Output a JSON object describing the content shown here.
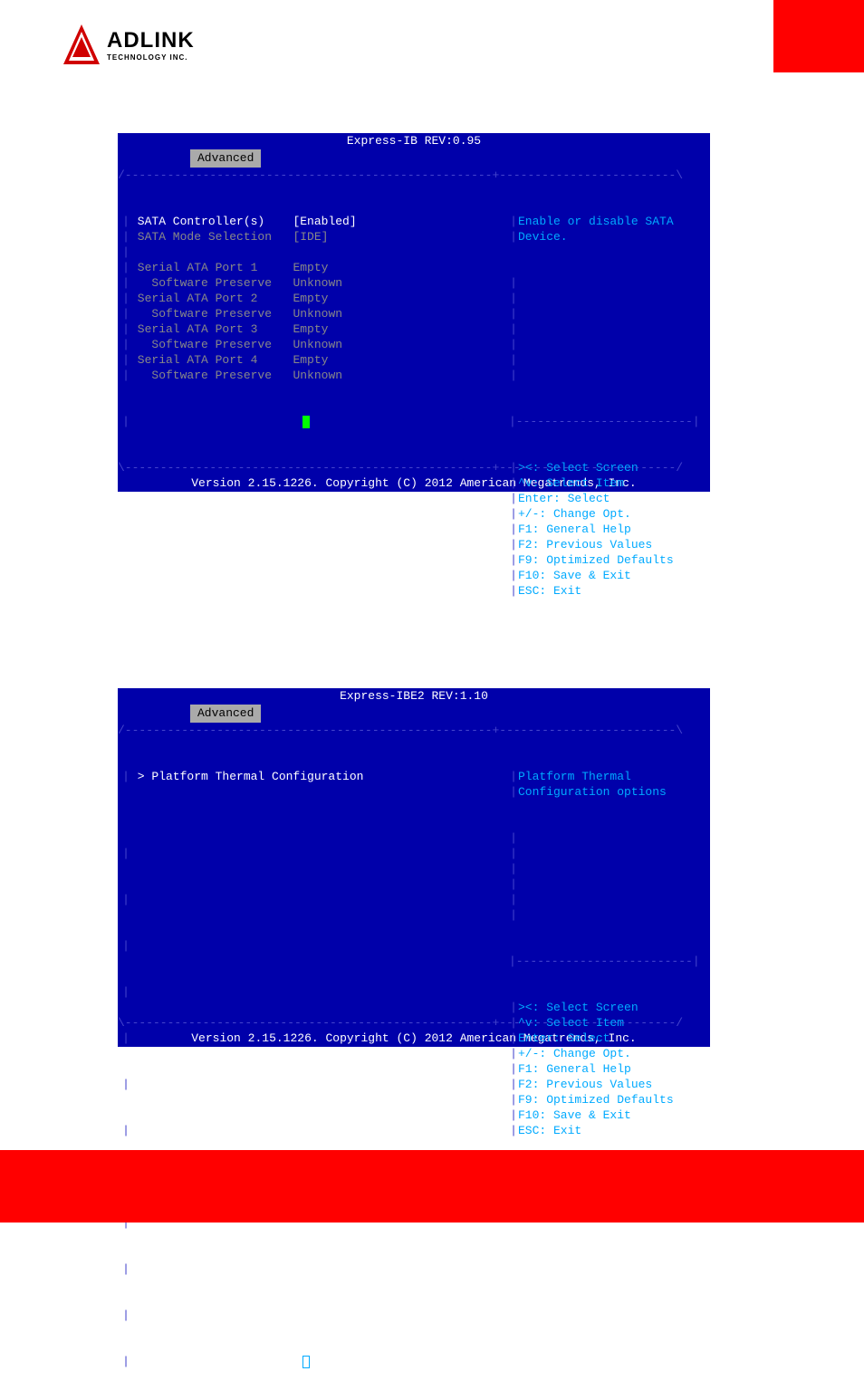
{
  "logo": {
    "name": "ADLINK",
    "sub": "TECHNOLOGY INC."
  },
  "bios1": {
    "title": "Express-IB REV:0.95",
    "tab": "Advanced",
    "items": [
      {
        "label": "SATA Controller(s)",
        "value": "[Enabled]",
        "hl": true
      },
      {
        "label": "SATA Mode Selection",
        "value": "[IDE]",
        "hl": false
      },
      {
        "label": "",
        "value": "",
        "hl": false
      },
      {
        "label": "Serial ATA Port 1",
        "value": "Empty",
        "hl": false
      },
      {
        "label": "  Software Preserve",
        "value": "Unknown",
        "hl": false
      },
      {
        "label": "Serial ATA Port 2",
        "value": "Empty",
        "hl": false
      },
      {
        "label": "  Software Preserve",
        "value": "Unknown",
        "hl": false
      },
      {
        "label": "Serial ATA Port 3",
        "value": "Empty",
        "hl": false
      },
      {
        "label": "  Software Preserve",
        "value": "Unknown",
        "hl": false
      },
      {
        "label": "Serial ATA Port 4",
        "value": "Empty",
        "hl": false
      },
      {
        "label": "  Software Preserve",
        "value": "Unknown",
        "hl": false
      }
    ],
    "help": [
      "Enable or disable SATA",
      "Device."
    ],
    "keys": [
      "><: Select Screen",
      "^v: Select Item",
      "Enter: Select",
      "+/-: Change Opt.",
      "F1: General Help",
      "F2: Previous Values",
      "F9: Optimized Defaults",
      "F10: Save & Exit",
      "ESC: Exit"
    ],
    "footer": "Version 2.15.1226. Copyright (C) 2012 American Megatrends, Inc."
  },
  "bios2": {
    "title": "Express-IBE2 REV:1.10",
    "tab": "Advanced",
    "items": [
      {
        "label": "> Platform Thermal Configuration",
        "value": "",
        "hl": true
      }
    ],
    "help": [
      "Platform Thermal",
      "Configuration options"
    ],
    "keys": [
      "><: Select Screen",
      "^v: Select Item",
      "Enter: Select",
      "+/-: Change Opt.",
      "F1: General Help",
      "F2: Previous Values",
      "F9: Optimized Defaults",
      "F10: Save & Exit",
      "ESC: Exit"
    ],
    "footer": "Version 2.15.1226. Copyright (C) 2012 American Megatrends, Inc."
  }
}
